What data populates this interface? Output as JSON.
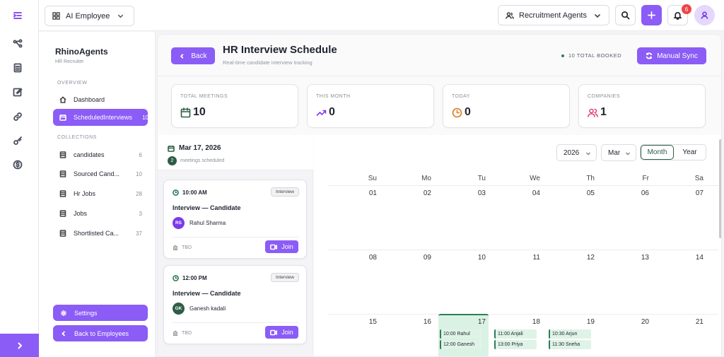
{
  "rail": {
    "icons": [
      "menu-collapse-icon",
      "workflow-icon",
      "document-icon",
      "edit-icon",
      "link-icon",
      "key-icon",
      "dollar-icon"
    ],
    "expand_icon": "chevron-right-icon"
  },
  "topbar": {
    "employee_select": "AI Employee",
    "agent_select": "Recruitment Agents",
    "notification_count": "6"
  },
  "sidebar": {
    "brand": "RhinoAgents",
    "brand_sub": "HR Recruiter",
    "overview_heading": "OVERVIEW",
    "overview_items": [
      {
        "label": "Dashboard",
        "count": ""
      },
      {
        "label": "ScheduledInterviews",
        "count": "10"
      }
    ],
    "collections_heading": "COLLECTIONS",
    "collection_items": [
      {
        "label": "candidates",
        "count": "6"
      },
      {
        "label": "Sourced Cand...",
        "count": "10"
      },
      {
        "label": "Hr Jobs",
        "count": "28"
      },
      {
        "label": "Jobs",
        "count": "3"
      },
      {
        "label": "Shortlisted Ca...",
        "count": "37"
      }
    ],
    "settings_label": "Settings",
    "back_employees_label": "Back to Employees"
  },
  "header": {
    "back_label": "Back",
    "title": "HR Interview Schedule",
    "subtitle": "Real-time candidate interview tracking",
    "booked": "10 TOTAL BOOKED",
    "sync_label": "Manual Sync"
  },
  "stats": [
    {
      "label": "TOTAL MEETINGS",
      "value": "10",
      "icon": "calendar-icon",
      "color": "#2e5d47"
    },
    {
      "label": "THIS MONTH",
      "value": "0",
      "icon": "trend-up-icon",
      "color": "#7c3aed"
    },
    {
      "label": "TODAY",
      "value": "0",
      "icon": "clock-icon",
      "color": "#e07a1f"
    },
    {
      "label": "COMPANIES",
      "value": "1",
      "icon": "users-icon",
      "color": "#e0457b"
    }
  ],
  "day_panel": {
    "date": "Mar 17, 2026",
    "count": "2",
    "count_label": "meetings scheduled",
    "meetings": [
      {
        "time": "10:00 AM",
        "tag": "Interview",
        "title": "Interview — Candidate",
        "initials": "RS",
        "name": "Rahul Sharma",
        "avatar_color": "#7c3aed",
        "location": "TBD",
        "join_label": "Join"
      },
      {
        "time": "12:00 PM",
        "tag": "Interview",
        "title": "Interview — Candidate",
        "initials": "GK",
        "name": "Ganesh kadali",
        "avatar_color": "#2e5d47",
        "location": "TBD",
        "join_label": "Join"
      }
    ]
  },
  "calendar": {
    "year": "2026",
    "month": "Mar",
    "view_month": "Month",
    "view_year": "Year",
    "weekdays": [
      "Su",
      "Mo",
      "Tu",
      "We",
      "Th",
      "Fr",
      "Sa"
    ],
    "weeks": [
      [
        "01",
        "02",
        "03",
        "04",
        "05",
        "06",
        "07"
      ],
      [
        "08",
        "09",
        "10",
        "11",
        "12",
        "13",
        "14"
      ],
      [
        "15",
        "16",
        "17",
        "18",
        "19",
        "20",
        "21"
      ]
    ],
    "today": "17",
    "events": {
      "17": [
        "10:00 Rahul",
        "12:00 Ganesh"
      ],
      "18": [
        "11:00 Anjali",
        "13:00 Priya"
      ],
      "19": [
        "10:30 Arjun",
        "11:30 Sneha"
      ]
    }
  },
  "colors": {
    "accent": "#8b5cf6",
    "green": "#2e5d47",
    "today_bg": "#d9f2e3"
  }
}
